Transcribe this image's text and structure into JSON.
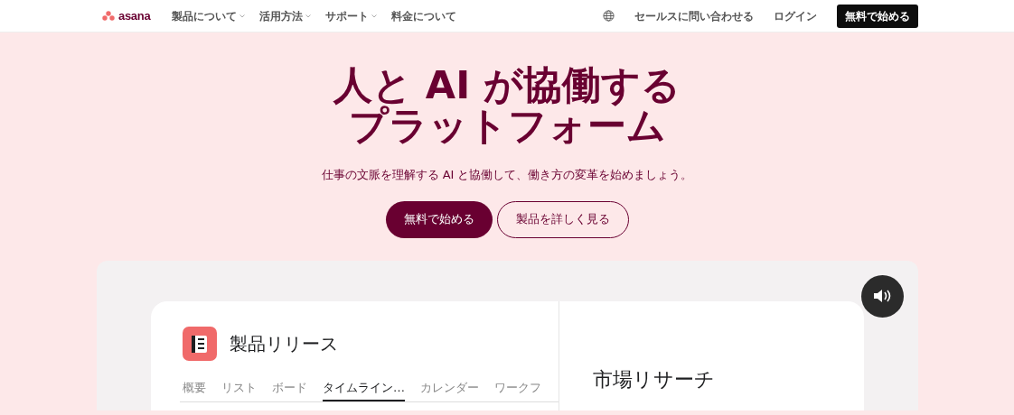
{
  "nav": {
    "logo": "asana",
    "menu": [
      {
        "label": "製品について",
        "dropdown": true
      },
      {
        "label": "活用方法",
        "dropdown": true
      },
      {
        "label": "サポート",
        "dropdown": true
      },
      {
        "label": "料金について",
        "dropdown": false
      }
    ],
    "contact": "セールスに問い合わせる",
    "login": "ログイン",
    "cta": "無料で始める"
  },
  "hero": {
    "title_lines": [
      "人と AI が協働する",
      "プラットフォーム"
    ],
    "subtitle": "仕事の文脈を理解する AI と協働して、働き方の変革を始めましょう。",
    "primary_button": "無料で始める",
    "secondary_button": "製品を詳しく見る"
  },
  "demo": {
    "project": {
      "title": "製品リリース",
      "tabs": [
        {
          "label": "概要",
          "selected": false
        },
        {
          "label": "リスト",
          "selected": false
        },
        {
          "label": "ボード",
          "selected": false
        },
        {
          "label": "タイムライン…",
          "selected": true
        },
        {
          "label": "カレンダー",
          "selected": false
        },
        {
          "label": "ワークフ",
          "selected": false
        }
      ]
    },
    "side_title": "市場リサーチ"
  }
}
